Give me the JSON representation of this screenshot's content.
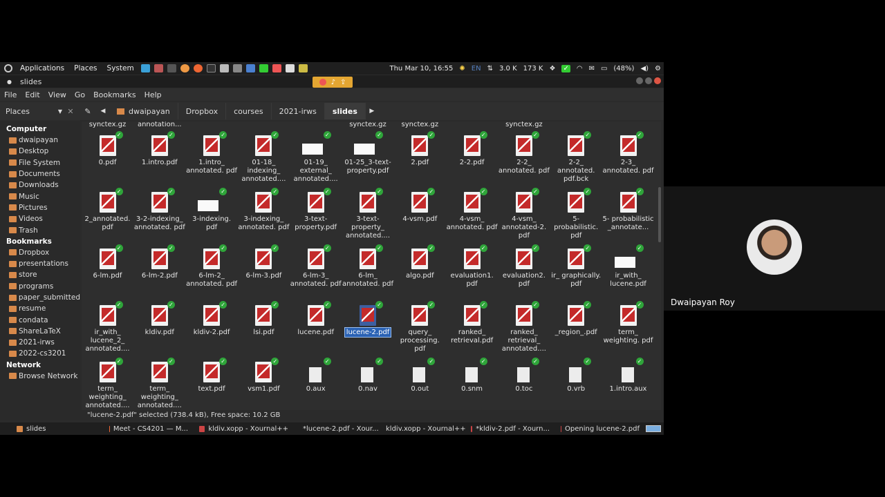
{
  "panel": {
    "menus": [
      "Applications",
      "Places",
      "System"
    ],
    "datetime": "Thu Mar 10, 16:55",
    "lang": "EN",
    "net_up": "3.0 K",
    "net_down": "173 K",
    "battery": "(48%)"
  },
  "window": {
    "title": "slides"
  },
  "menubar": [
    "File",
    "Edit",
    "View",
    "Go",
    "Bookmarks",
    "Help"
  ],
  "toolbar": {
    "places_label": "Places",
    "breadcrumbs": [
      "dwaipayan",
      "Dropbox",
      "courses",
      "2021-irws",
      "slides"
    ]
  },
  "sidebar": {
    "computer_header": "Computer",
    "computer_items": [
      "dwaipayan",
      "Desktop",
      "File System",
      "Documents",
      "Downloads",
      "Music",
      "Pictures",
      "Videos",
      "Trash"
    ],
    "bookmarks_header": "Bookmarks",
    "bookmark_items": [
      "Dropbox",
      "presentations",
      "store",
      "programs",
      "paper_submitted",
      "resume",
      "condata",
      "ShareLaTeX",
      "2021-irws",
      "2022-cs3201"
    ],
    "network_header": "Network",
    "network_items": [
      "Browse Network"
    ]
  },
  "top_partial_labels": [
    "synctex.gz",
    "annotation...",
    "synctex.gz",
    "synctex.gz",
    "synctex.gz"
  ],
  "files": [
    [
      "0.pdf",
      "1.intro.pdf",
      "1.intro_ annotated. pdf",
      "01-18_ indexing_ annotated....",
      "01-19_ external_ annotated....",
      "01-25_3-text- property.pdf",
      "2.pdf",
      "2-2.pdf",
      "2-2_ annotated. pdf",
      "2-2_ annotated. pdf.bck",
      "2-3_ annotated. pdf"
    ],
    [
      "2_annotated. pdf",
      "3-2-indexing_ annotated. pdf",
      "3-indexing. pdf",
      "3-indexing_ annotated. pdf",
      "3-text- property.pdf",
      "3-text- property_ annotated....",
      "4-vsm.pdf",
      "4-vsm_ annotated. pdf",
      "4-vsm_ annotated-2. pdf",
      "5- probabilistic. pdf",
      "5- probabilistic _annotate..."
    ],
    [
      "6-lm.pdf",
      "6-lm-2.pdf",
      "6-lm-2_ annotated. pdf",
      "6-lm-3.pdf",
      "6-lm-3_ annotated. pdf",
      "6-lm_ annotated. pdf",
      "algo.pdf",
      "evaluation1. pdf",
      "evaluation2. pdf",
      "ir_ graphically. pdf",
      "ir_with_ lucene.pdf"
    ],
    [
      "ir_with_ lucene_2_ annotated....",
      "kldiv.pdf",
      "kldiv-2.pdf",
      "lsi.pdf",
      "lucene.pdf",
      "lucene-2.pdf",
      "query_ processing. pdf",
      "ranked_ retrieval.pdf",
      "ranked_ retrieval_ annotated....",
      "_region_.pdf",
      "term_ weighting. pdf"
    ],
    [
      "term_ weighting_ annotated....",
      "term_ weighting_ annotated....",
      "text.pdf",
      "vsm1.pdf",
      "0.aux",
      "0.nav",
      "0.out",
      "0.snm",
      "0.toc",
      "0.vrb",
      "1.intro.aux"
    ]
  ],
  "status_text": "\"lucene-2.pdf\" selected (738.4 kB), Free space: 10.2 GB",
  "taskbar": [
    "slides",
    "Meet - CS4201 — M...",
    "kldiv.xopp - Xournal++",
    "*lucene-2.pdf - Xour...",
    "kldiv.xopp - Xournal++",
    "*kldiv-2.pdf - Xourn...",
    "Opening lucene-2.pdf"
  ],
  "participant": {
    "name": "Dwaipayan Roy"
  }
}
